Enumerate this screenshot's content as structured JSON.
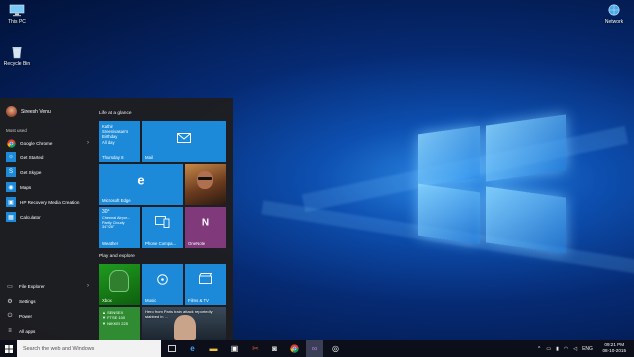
{
  "desktop": {
    "icons": [
      {
        "label": "This PC",
        "icon": "computer-icon"
      },
      {
        "label": "Recycle Bin",
        "icon": "recycle-bin-icon"
      },
      {
        "label": "Network",
        "icon": "network-icon"
      }
    ]
  },
  "start_menu": {
    "user": "Sireesh Venu",
    "most_used_label": "Most used",
    "apps": [
      {
        "label": "Google Chrome",
        "icon": "chrome-icon",
        "has_submenu": true
      },
      {
        "label": "Get Started",
        "icon": "lightbulb-icon",
        "has_submenu": false
      },
      {
        "label": "Get Skype",
        "icon": "skype-icon",
        "has_submenu": false
      },
      {
        "label": "Maps",
        "icon": "maps-icon",
        "has_submenu": false
      },
      {
        "label": "HP Recovery Media Creation",
        "icon": "hp-icon",
        "has_submenu": false
      },
      {
        "label": "Calculator",
        "icon": "calculator-icon",
        "has_submenu": false
      }
    ],
    "bottom": [
      {
        "label": "File Explorer",
        "icon": "folder-icon",
        "has_submenu": true
      },
      {
        "label": "Settings",
        "icon": "gear-icon",
        "has_submenu": false
      },
      {
        "label": "Power",
        "icon": "power-icon",
        "has_submenu": false
      },
      {
        "label": "All apps",
        "icon": "all-apps-icon",
        "has_submenu": false
      }
    ],
    "groups": {
      "life": "Life at a glance",
      "play": "Play and explore"
    },
    "tiles": {
      "calendar": {
        "text": "Kathir Sreenivasan's Birthday\nAll day",
        "label": "Thursday 8"
      },
      "mail": {
        "label": "Mail"
      },
      "edge": {
        "label": "Microsoft Edge"
      },
      "photos": {
        "label": ""
      },
      "weather": {
        "temp": "30°",
        "text": "Chennai Airpor...\nPartly Cloudy\n34°/26°",
        "label": "Weather"
      },
      "phone": {
        "label": "Phone Compa..."
      },
      "onenote": {
        "label": "OneNote"
      },
      "xbox": {
        "label": "Xbox"
      },
      "music": {
        "label": "Music"
      },
      "films": {
        "label": "Films & TV"
      },
      "money": {
        "text": "▲ SENSEX\n▼ FTSE 100\n▼ NIKKEI 225",
        "label": ""
      },
      "news": {
        "text": "Hero from Paris train attack reportedly stabbed in ...",
        "label": ""
      }
    }
  },
  "taskbar": {
    "search_placeholder": "Search the web and Windows",
    "pinned": [
      "task-view-icon",
      "edge-icon",
      "file-explorer-icon",
      "store-icon",
      "snipping-icon",
      "camera-icon",
      "chrome-icon",
      "visual-studio-icon",
      "media-icon"
    ],
    "tray_caret": "^",
    "language": "ENG",
    "time": "09:21 PM",
    "date": "08-10-2015"
  },
  "colors": {
    "accent_blue": "#1c8ad9",
    "start_bg": "#1e1e20",
    "taskbar_bg": "#0c0f19",
    "onenote_purple": "#80397b",
    "xbox_green": "#107c10",
    "money_green": "#2f8c32"
  }
}
